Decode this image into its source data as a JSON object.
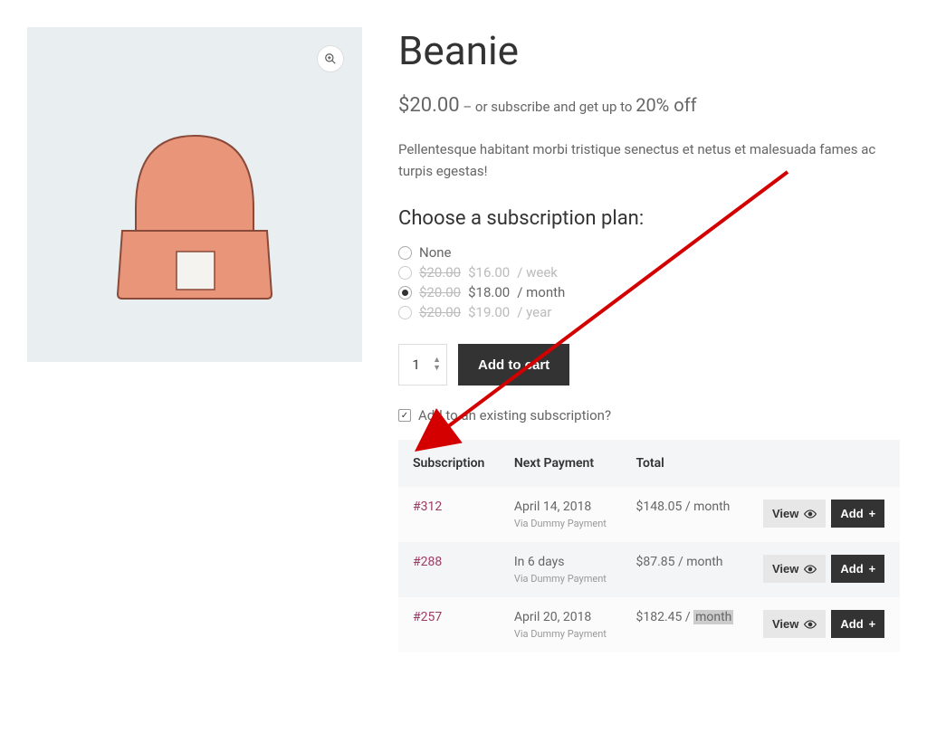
{
  "product": {
    "title": "Beanie",
    "price": "$20.00",
    "subscribe_prefix": " – or subscribe and get up to ",
    "discount": "20% off",
    "description": "Pellentesque habitant morbi tristique senectus et netus et malesuada fames ac turpis egestas!"
  },
  "plan": {
    "heading": "Choose a subscription plan:",
    "options": [
      {
        "label": "None",
        "strike": "",
        "price": "",
        "unit": "",
        "disabled": false,
        "selected": false
      },
      {
        "label": "",
        "strike": "$20.00",
        "price": "$16.00",
        "unit": "/ week",
        "disabled": true,
        "selected": false
      },
      {
        "label": "",
        "strike": "$20.00",
        "price": "$18.00",
        "unit": "/ month",
        "disabled": false,
        "selected": true
      },
      {
        "label": "",
        "strike": "$20.00",
        "price": "$19.00",
        "unit": "/ year",
        "disabled": true,
        "selected": false
      }
    ]
  },
  "cart": {
    "quantity": "1",
    "add_label": "Add to cart"
  },
  "existing": {
    "checked": true,
    "label": "Add to an existing subscription?"
  },
  "table": {
    "headers": {
      "sub": "Subscription",
      "next": "Next Payment",
      "total": "Total",
      "actions": ""
    },
    "rows": [
      {
        "id": "#312",
        "next": "April 14, 2018",
        "via": "Via Dummy Payment",
        "total": "$148.05 / month",
        "total_hl": ""
      },
      {
        "id": "#288",
        "next": "In 6 days",
        "via": "Via Dummy Payment",
        "total": "$87.85 / month",
        "total_hl": ""
      },
      {
        "id": "#257",
        "next": "April 20, 2018",
        "via": "Via Dummy Payment",
        "total": "$182.45 / ",
        "total_hl": "month"
      }
    ],
    "view_label": "View",
    "add_label": "Add"
  }
}
